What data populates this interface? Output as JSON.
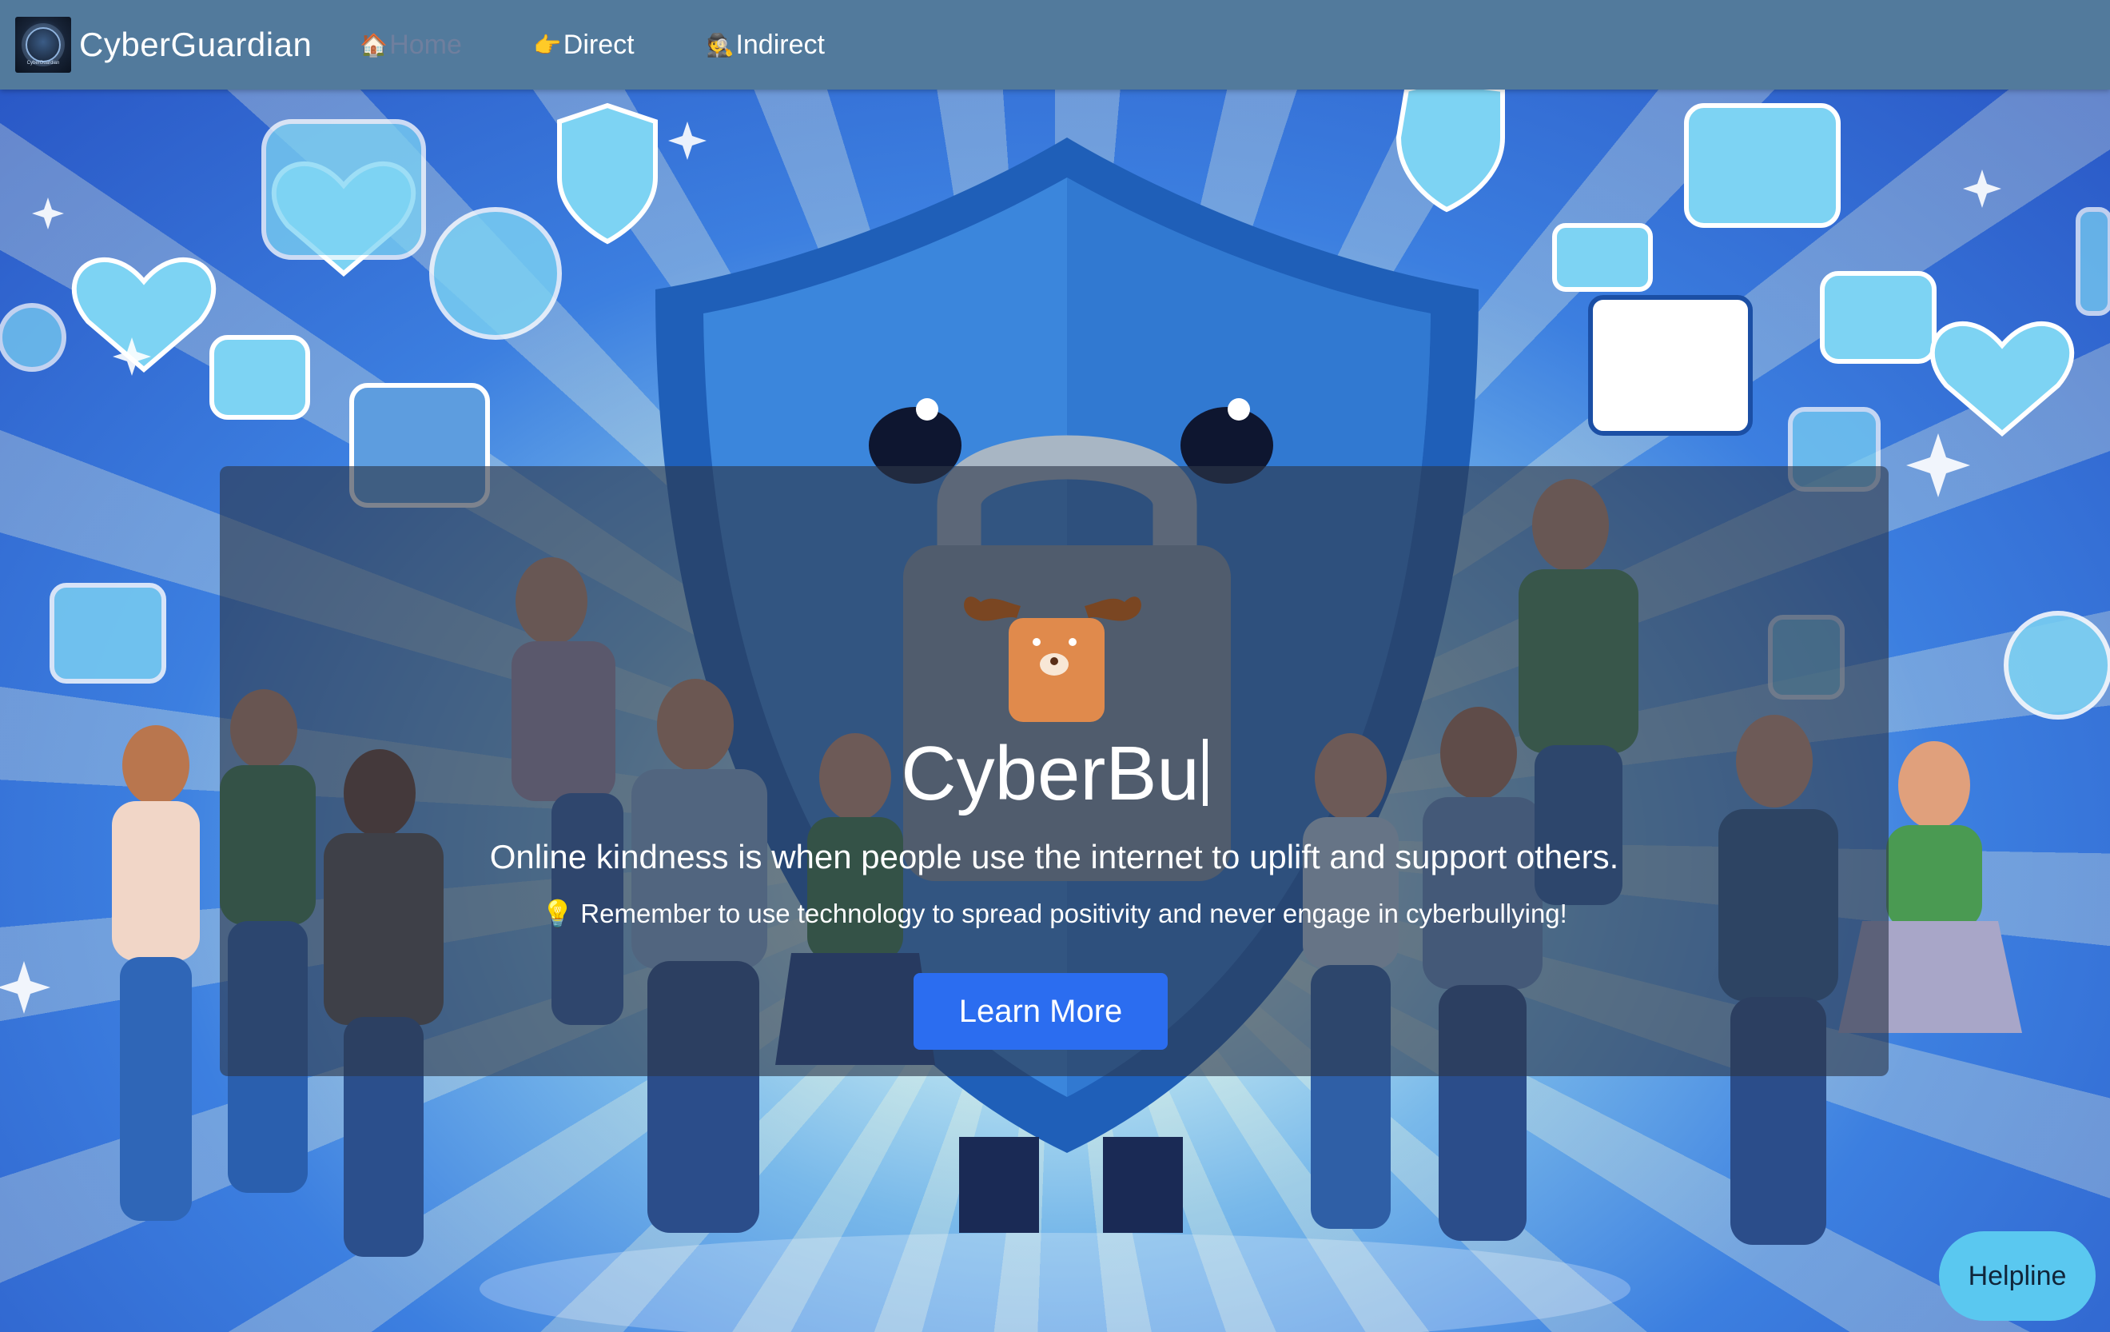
{
  "nav": {
    "brand_name": "CyberGuardian",
    "brand_logo_text": "CyberGuardian",
    "items": [
      {
        "emoji": "🏠",
        "label": "Home",
        "active": true
      },
      {
        "emoji": "👉",
        "label": "Direct",
        "active": false
      },
      {
        "emoji": "🕵",
        "label": "Indirect",
        "active": false
      }
    ]
  },
  "hero": {
    "title": "CyberBu",
    "subtitle": "Online kindness is when people use the internet to uplift and support others.",
    "tip_icon": "💡",
    "tip": "Remember to use technology to spread positivity and never engage in cyberbullying!",
    "cta_label": "Learn More"
  },
  "helpline": {
    "label": "Helpline"
  },
  "colors": {
    "navbar": "#527a9c",
    "active_nav": "#6f7f9e",
    "cta": "#2b6df0",
    "helpline": "#5ac8f0",
    "overlay": "rgba(45,55,72,0.62)"
  }
}
